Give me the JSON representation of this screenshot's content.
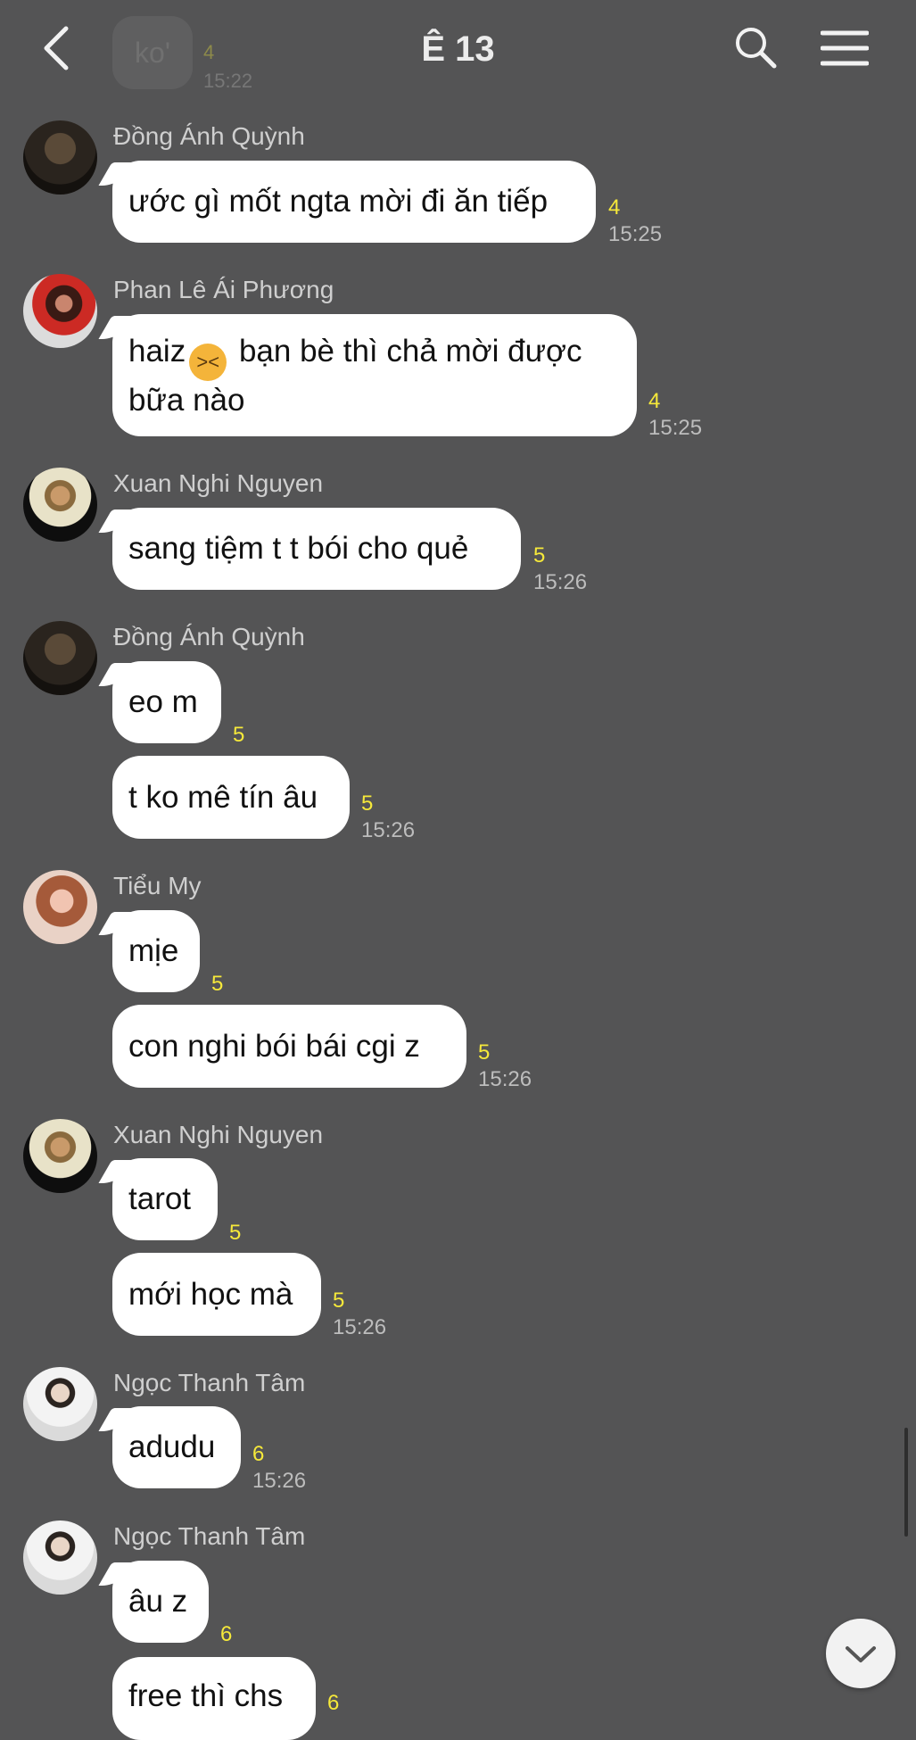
{
  "header": {
    "title": "Ê 13"
  },
  "ghost": {
    "text": "ko'",
    "count": "4",
    "time": "15:22"
  },
  "messages": [
    {
      "sender": "Đồng Ánh Quỳnh",
      "text": "ước gì mốt ngta mời đi ăn tiếp",
      "count": "4",
      "time": "15:25"
    },
    {
      "sender": "Phan Lê Ái Phương",
      "line1_pre": "haiz",
      "emoji": "😩",
      "line1_post": " bạn bè thì chả mời được",
      "line2": "bữa nào",
      "count": "4",
      "time": "15:25"
    },
    {
      "sender": "Xuan Nghi Nguyen",
      "text": "sang tiệm t t bói cho quẻ",
      "count": "5",
      "time": "15:26"
    },
    {
      "sender": "Đồng Ánh Quỳnh",
      "text": "eo m",
      "count": "5"
    },
    {
      "text": "t ko mê tín âu",
      "count": "5",
      "time": "15:26"
    },
    {
      "sender": "Tiểu My",
      "text": "mịe",
      "count": "5"
    },
    {
      "text": "con nghi bói bái cgi z",
      "count": "5",
      "time": "15:26"
    },
    {
      "sender": "Xuan Nghi Nguyen",
      "text": "tarot",
      "count": "5"
    },
    {
      "text": "mới học mà",
      "count": "5",
      "time": "15:26"
    },
    {
      "sender": "Ngọc Thanh Tâm",
      "text": "adudu",
      "count": "6",
      "time": "15:26"
    },
    {
      "sender": "Ngọc Thanh Tâm",
      "text": "âu z",
      "count": "6"
    },
    {
      "text": "free thì chs",
      "count": "6"
    }
  ]
}
